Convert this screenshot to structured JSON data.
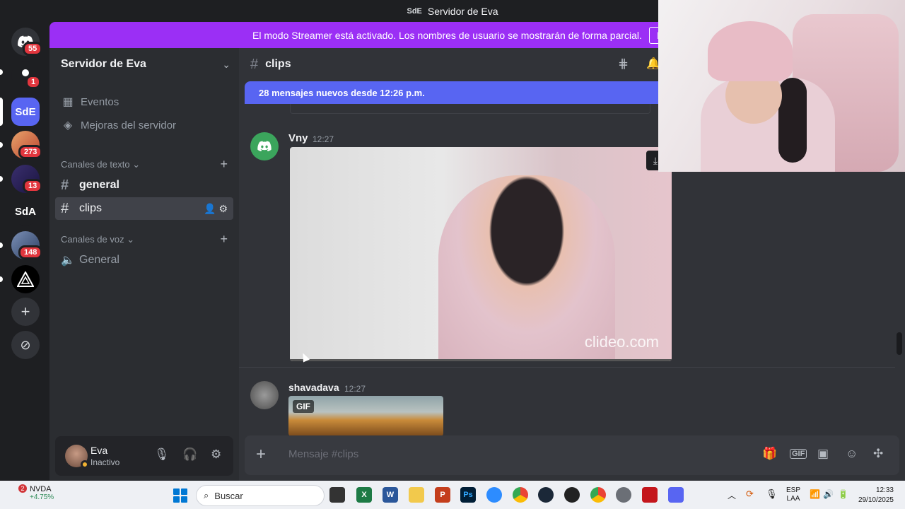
{
  "window": {
    "logo_text": "SdE",
    "title": "Servidor de Eva"
  },
  "server_rail": {
    "items": [
      {
        "name": "Discord",
        "badge": "55"
      },
      {
        "name": "server-2",
        "badge": "1"
      },
      {
        "name": "SdE",
        "badge": ""
      },
      {
        "name": "server-4",
        "badge": "273"
      },
      {
        "name": "server-5",
        "badge": "13"
      },
      {
        "name": "SdA",
        "badge": ""
      },
      {
        "name": "server-7",
        "badge": "148"
      },
      {
        "name": "server-8",
        "badge": ""
      }
    ],
    "add_label": "+",
    "explore_label": "⊘"
  },
  "streamer_banner": {
    "text": "El modo Streamer está activado. Los nombres de usuario se mostrarán de forma parcial.",
    "button": "Desac"
  },
  "sidebar": {
    "server_name": "Servidor de Eva",
    "items": [
      {
        "label": "Eventos"
      },
      {
        "label": "Mejoras del servidor"
      }
    ],
    "text_category": "Canales de texto",
    "text_channels": [
      {
        "label": "general"
      },
      {
        "label": "clips"
      }
    ],
    "voice_category": "Canales de voz",
    "voice_channels": [
      {
        "label": "General"
      }
    ]
  },
  "user_panel": {
    "name": "Eva",
    "status": "Inactivo"
  },
  "chat": {
    "channel": "clips",
    "new_messages": "28 mensajes nuevos desde 12:26 p.m.",
    "messages": [
      {
        "author": "Vny",
        "time": "12:27",
        "attachment": "video",
        "watermark": "clideo.com"
      },
      {
        "author": "shavadava",
        "time": "12:27",
        "attachment": "gif",
        "tag": "GIF"
      }
    ],
    "composer_placeholder": "Mensaje #clips"
  },
  "taskbar": {
    "stock_name": "NVDA",
    "stock_change": "+4.75%",
    "stock_badge": "2",
    "search_label": "Buscar",
    "lang_1": "ESP",
    "lang_2": "LAA",
    "time": "12:33",
    "date": "29/10/2025"
  },
  "colors": {
    "banner": "#9b2ff5",
    "new_messages": "#5865f2",
    "badge": "#e2363e",
    "sidebar": "#2b2d31",
    "chat": "#313338"
  }
}
